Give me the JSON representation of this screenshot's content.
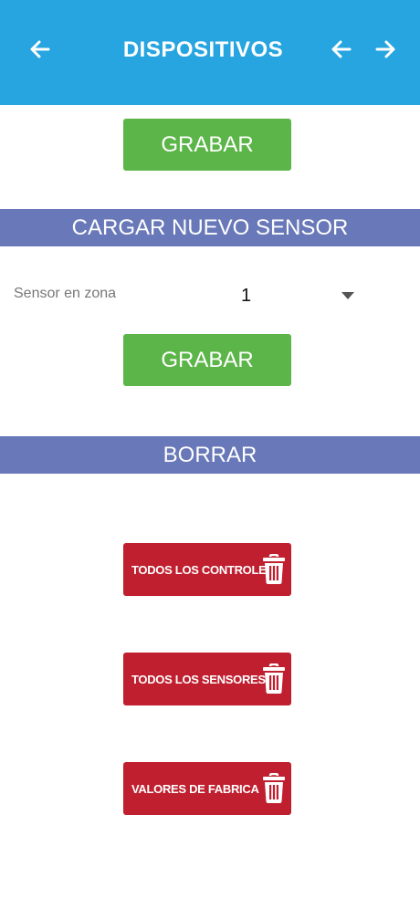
{
  "colors": {
    "header_bg": "#27a5e0",
    "green": "#5cb548",
    "section_bar": "#6878b8",
    "red": "#c01f2f"
  },
  "header": {
    "title": "DISPOSITIVOS",
    "back_icon": "arrow-left-icon",
    "prev_icon": "arrow-left-icon",
    "next_icon": "arrow-right-icon"
  },
  "top_save": {
    "label": "GRABAR"
  },
  "new_sensor": {
    "section_title": "CARGAR NUEVO SENSOR",
    "field_label": "Sensor en zona",
    "zone_value": "1",
    "dropdown_icon": "caret-down-icon",
    "save_label": "GRABAR"
  },
  "delete": {
    "section_title": "BORRAR",
    "buttons": [
      {
        "label": "TODOS LOS CONTROLES",
        "icon": "trash-icon"
      },
      {
        "label": "TODOS LOS SENSORES",
        "icon": "trash-icon"
      },
      {
        "label": "VALORES DE FABRICA",
        "icon": "trash-icon"
      }
    ]
  }
}
